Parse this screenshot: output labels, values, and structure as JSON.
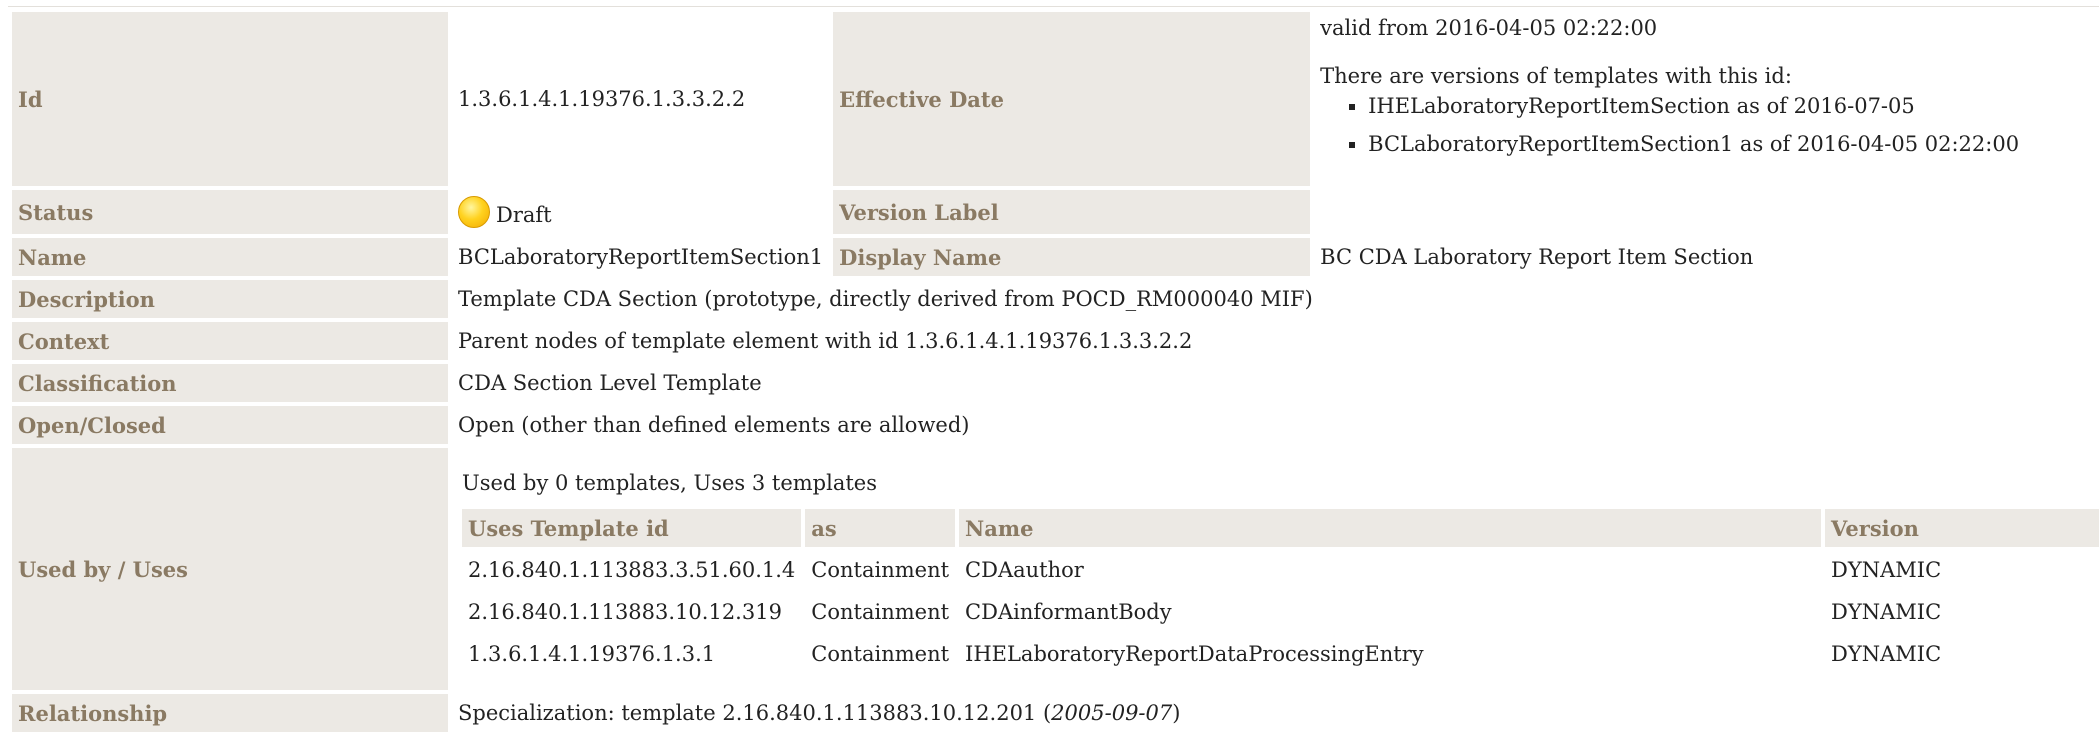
{
  "template": {
    "id_label": "Id",
    "id_value": "1.3.6.1.4.1.19376.1.3.3.2.2",
    "effective_label": "Effective Date",
    "valid_from": "valid from 2016-04-05 02:22:00",
    "versions_intro": "There are versions of templates with this id:",
    "versions": [
      "IHELaboratoryReportItemSection as of 2016-07-05",
      "BCLaboratoryReportItemSection1 as of 2016-04-05 02:22:00"
    ],
    "status_label": "Status",
    "status_value": "Draft",
    "version_label_label": "Version Label",
    "name_label": "Name",
    "name_value": "BCLaboratoryReportItemSection1",
    "display_name_label": "Display Name",
    "display_name_value": "BC CDA Laboratory Report Item Section",
    "description_label": "Description",
    "description_value": "Template CDA Section (prototype, directly derived from POCD_RM000040 MIF)",
    "context_label": "Context",
    "context_value": "Parent nodes of template element with id 1.3.6.1.4.1.19376.1.3.3.2.2",
    "classification_label": "Classification",
    "classification_value": "CDA Section Level Template",
    "openclosed_label": "Open/Closed",
    "openclosed_value": "Open (other than defined elements are allowed)",
    "usedby_label": "Used by / Uses",
    "usedby_caption": "Used by 0 templates, Uses 3 templates",
    "uses_headers": [
      "Uses Template id",
      "as",
      "Name",
      "Version"
    ],
    "uses_rows": [
      [
        "2.16.840.1.113883.3.51.60.1.4",
        "Containment",
        "CDAauthor",
        "DYNAMIC"
      ],
      [
        "2.16.840.1.113883.10.12.319",
        "Containment",
        "CDAinformantBody",
        "DYNAMIC"
      ],
      [
        "1.3.6.1.4.1.19376.1.3.1",
        "Containment",
        "IHELaboratoryReportDataProcessingEntry",
        "DYNAMIC"
      ]
    ],
    "relationship_label": "Relationship",
    "relationship_prefix": "Specialization: template 2.16.840.1.113883.10.12.201 (",
    "relationship_date": "2005-09-07",
    "relationship_suffix": ")"
  },
  "colors": {
    "label_bg": "#ece9e4",
    "label_text": "#8a7a63",
    "status_draft": "#ffd21f"
  },
  "icons": {
    "status": "draft-status-icon"
  }
}
